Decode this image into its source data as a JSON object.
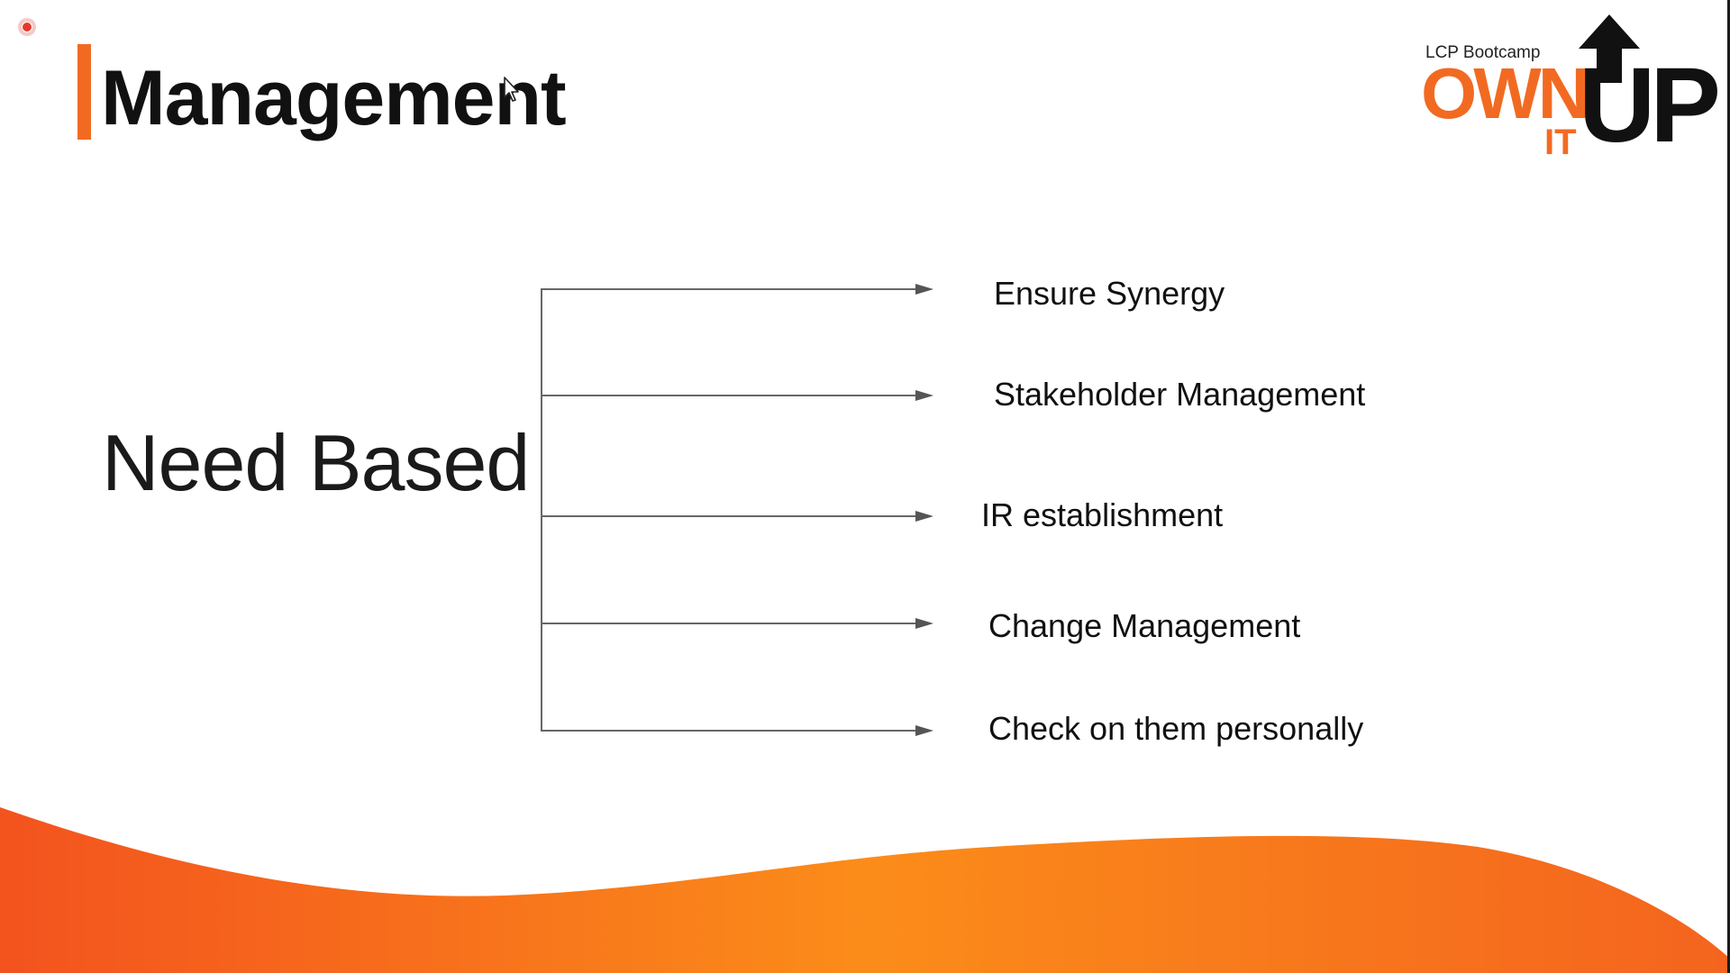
{
  "slide": {
    "title": "Management",
    "subject": "Need Based",
    "items": [
      {
        "label": "Ensure Synergy"
      },
      {
        "label": "Stakeholder Management"
      },
      {
        "label": "IR establishment"
      },
      {
        "label": "Change Management"
      },
      {
        "label": "Check on them personally"
      }
    ]
  },
  "logo": {
    "tagline": "LCP Bootcamp",
    "word1": "OWN",
    "word2": "IT",
    "word3": "UP"
  },
  "colors": {
    "accent": "#f26a22",
    "wave_light": "#fb8c1a",
    "wave_dark": "#f3531e",
    "text": "#111111"
  },
  "icons": {
    "record": "record-indicator-icon",
    "cursor": "mouse-cursor-icon",
    "arrow": "arrow-right-icon"
  }
}
